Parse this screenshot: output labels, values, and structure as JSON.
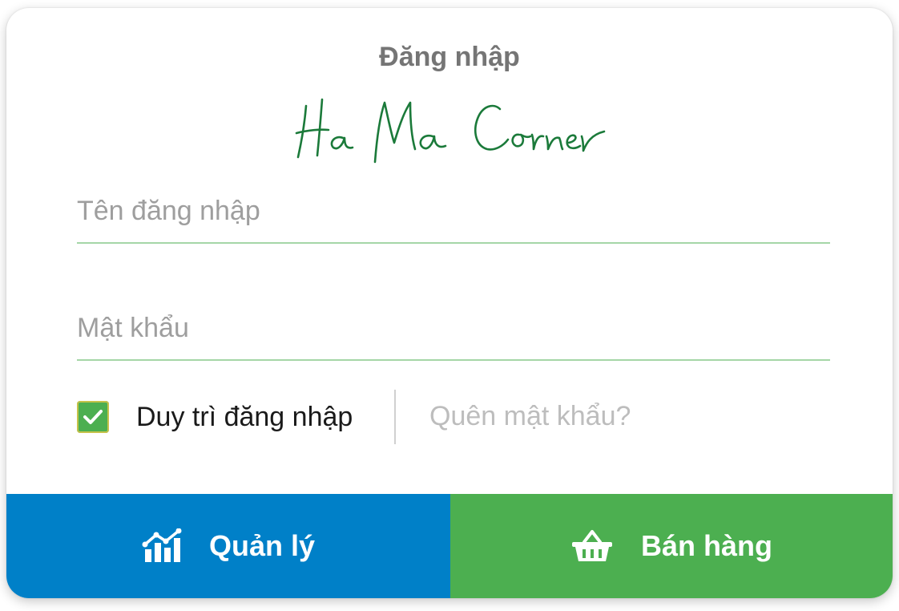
{
  "login": {
    "title": "Đăng nhập",
    "brand": "Ha Ma Corner",
    "brand_color": "#1b7a3a",
    "username_placeholder": "Tên đăng nhập",
    "password_placeholder": "Mật khẩu",
    "remember_label": "Duy trì đăng nhập",
    "remember_checked": true,
    "forgot_link": "Quên mật khẩu?"
  },
  "actions": {
    "manage_label": "Quản lý",
    "manage_icon": "bar-chart-icon",
    "manage_color": "#0080c8",
    "sell_label": "Bán hàng",
    "sell_icon": "shopping-basket-icon",
    "sell_color": "#4caf50"
  },
  "colors": {
    "field_underline": "#a5d6a7",
    "checkbox": "#4caf50",
    "title": "#757575"
  }
}
